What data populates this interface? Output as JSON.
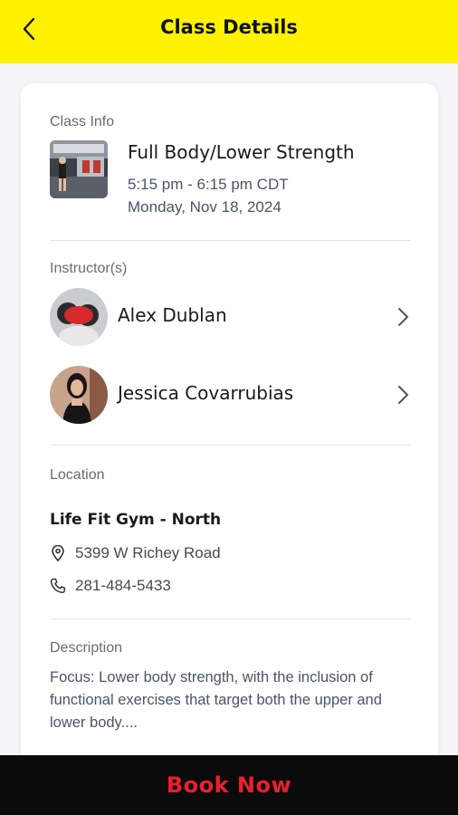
{
  "header": {
    "title": "Class Details",
    "back_icon": "chevron-left-icon"
  },
  "class_info": {
    "section_label": "Class Info",
    "name": "Full Body/Lower Strength",
    "time": "5:15 pm - 6:15 pm CDT",
    "date": "Monday, Nov 18, 2024"
  },
  "instructors": {
    "section_label": "Instructor(s)",
    "items": [
      {
        "name": "Alex Dublan"
      },
      {
        "name": "Jessica Covarrubias"
      }
    ]
  },
  "location": {
    "section_label": "Location",
    "gym_name": "Life Fit Gym - North",
    "address": "5399 W Richey Road",
    "phone": "281-484-5433"
  },
  "description": {
    "section_label": "Description",
    "text": "Focus: Lower body strength, with the inclusion of functional exercises that target both the upper and lower body...."
  },
  "footer": {
    "book_label": "Book Now"
  },
  "colors": {
    "header_bg": "#fff200",
    "book_text": "#e8202e",
    "footer_bg": "#0b0b0b"
  }
}
